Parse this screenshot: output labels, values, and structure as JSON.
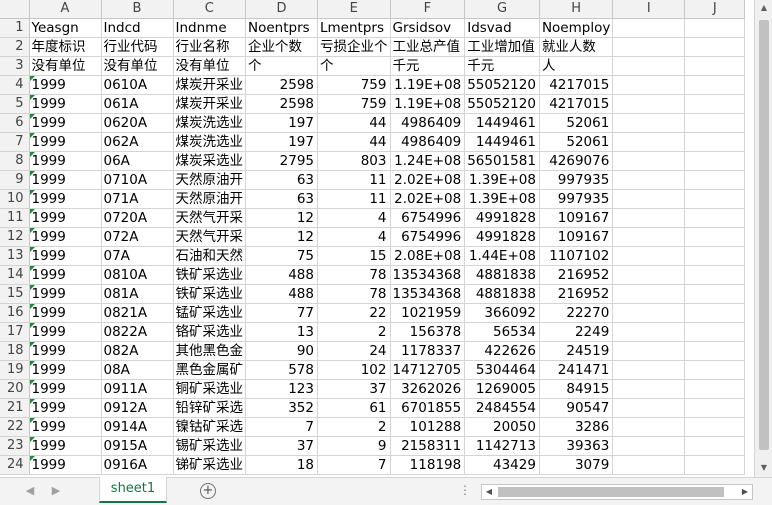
{
  "columns": [
    "A",
    "B",
    "C",
    "D",
    "E",
    "F",
    "G",
    "H",
    "I",
    "J"
  ],
  "rows": [
    {
      "n": "1",
      "cells": [
        "Yeasgn",
        "Indcd",
        "Indnme",
        "Noentprs",
        "Lmentprs",
        "Grsidsov",
        "Idsvad",
        "Noemploy",
        "",
        ""
      ]
    },
    {
      "n": "2",
      "cells": [
        "年度标识",
        "行业代码",
        "行业名称",
        "企业个数",
        "亏损企业个",
        "工业总产值",
        "工业增加值",
        "就业人数",
        "",
        ""
      ]
    },
    {
      "n": "3",
      "cells": [
        "没有单位",
        "没有单位",
        "没有单位",
        "个",
        "个",
        "千元",
        "千元",
        "人",
        "",
        ""
      ]
    },
    {
      "n": "4",
      "cells": [
        "1999",
        "0610A",
        "煤炭开采业",
        "2598",
        "759",
        "1.19E+08",
        "55052120",
        "4217015",
        "",
        ""
      ]
    },
    {
      "n": "5",
      "cells": [
        "1999",
        "061A",
        "煤炭开采业",
        "2598",
        "759",
        "1.19E+08",
        "55052120",
        "4217015",
        "",
        ""
      ]
    },
    {
      "n": "6",
      "cells": [
        "1999",
        "0620A",
        "煤炭洗选业",
        "197",
        "44",
        "4986409",
        "1449461",
        "52061",
        "",
        ""
      ]
    },
    {
      "n": "7",
      "cells": [
        "1999",
        "062A",
        "煤炭洗选业",
        "197",
        "44",
        "4986409",
        "1449461",
        "52061",
        "",
        ""
      ]
    },
    {
      "n": "8",
      "cells": [
        "1999",
        "06A",
        "煤炭采选业",
        "2795",
        "803",
        "1.24E+08",
        "56501581",
        "4269076",
        "",
        ""
      ]
    },
    {
      "n": "9",
      "cells": [
        "1999",
        "0710A",
        "天然原油开",
        "63",
        "11",
        "2.02E+08",
        "1.39E+08",
        "997935",
        "",
        ""
      ]
    },
    {
      "n": "10",
      "cells": [
        "1999",
        "071A",
        "天然原油开",
        "63",
        "11",
        "2.02E+08",
        "1.39E+08",
        "997935",
        "",
        ""
      ]
    },
    {
      "n": "11",
      "cells": [
        "1999",
        "0720A",
        "天然气开采",
        "12",
        "4",
        "6754996",
        "4991828",
        "109167",
        "",
        ""
      ]
    },
    {
      "n": "12",
      "cells": [
        "1999",
        "072A",
        "天然气开采",
        "12",
        "4",
        "6754996",
        "4991828",
        "109167",
        "",
        ""
      ]
    },
    {
      "n": "13",
      "cells": [
        "1999",
        "07A",
        "石油和天然",
        "75",
        "15",
        "2.08E+08",
        "1.44E+08",
        "1107102",
        "",
        ""
      ]
    },
    {
      "n": "14",
      "cells": [
        "1999",
        "0810A",
        "铁矿采选业",
        "488",
        "78",
        "13534368",
        "4881838",
        "216952",
        "",
        ""
      ]
    },
    {
      "n": "15",
      "cells": [
        "1999",
        "081A",
        "铁矿采选业",
        "488",
        "78",
        "13534368",
        "4881838",
        "216952",
        "",
        ""
      ]
    },
    {
      "n": "16",
      "cells": [
        "1999",
        "0821A",
        "锰矿采选业",
        "77",
        "22",
        "1021959",
        "366092",
        "22270",
        "",
        ""
      ]
    },
    {
      "n": "17",
      "cells": [
        "1999",
        "0822A",
        "铬矿采选业",
        "13",
        "2",
        "156378",
        "56534",
        "2249",
        "",
        ""
      ]
    },
    {
      "n": "18",
      "cells": [
        "1999",
        "082A",
        "其他黑色金",
        "90",
        "24",
        "1178337",
        "422626",
        "24519",
        "",
        ""
      ]
    },
    {
      "n": "19",
      "cells": [
        "1999",
        "08A",
        "黑色金属矿",
        "578",
        "102",
        "14712705",
        "5304464",
        "241471",
        "",
        ""
      ]
    },
    {
      "n": "20",
      "cells": [
        "1999",
        "0911A",
        "铜矿采选业",
        "123",
        "37",
        "3262026",
        "1269005",
        "84915",
        "",
        ""
      ]
    },
    {
      "n": "21",
      "cells": [
        "1999",
        "0912A",
        "铅锌矿采选",
        "352",
        "61",
        "6701855",
        "2484554",
        "90547",
        "",
        ""
      ]
    },
    {
      "n": "22",
      "cells": [
        "1999",
        "0914A",
        "镍钴矿采选",
        "7",
        "2",
        "101288",
        "20050",
        "3286",
        "",
        ""
      ]
    },
    {
      "n": "23",
      "cells": [
        "1999",
        "0915A",
        "锡矿采选业",
        "37",
        "9",
        "2158311",
        "1142713",
        "39363",
        "",
        ""
      ]
    },
    {
      "n": "24",
      "cells": [
        "1999",
        "0916A",
        "锑矿采选业",
        "18",
        "7",
        "118198",
        "43429",
        "3079",
        "",
        ""
      ]
    }
  ],
  "sheet_tab": "sheet1",
  "add_sheet_symbol": "+",
  "more_tabs_symbol": "⋮",
  "icons": {
    "scroll_up": "scroll-up-arrow-icon",
    "scroll_down": "scroll-down-arrow-icon",
    "scroll_left": "scroll-left-arrow-icon",
    "scroll_right": "scroll-right-arrow-icon",
    "prev_sheet": "prev-sheet-icon",
    "next_sheet": "next-sheet-icon"
  },
  "colors": {
    "accent": "#1e7145",
    "error_indicator": "#1f8a3a",
    "header_bg": "#f2f2f2"
  }
}
